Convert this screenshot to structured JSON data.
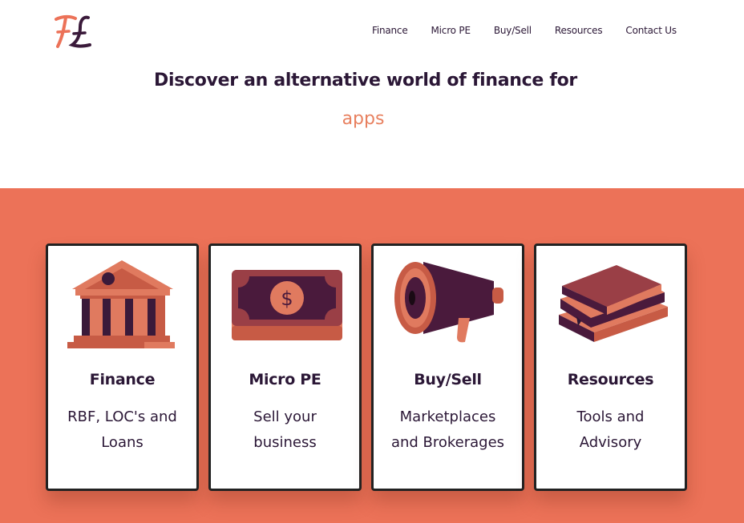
{
  "brand": {
    "logo_text": "FL",
    "colors": {
      "accent": "#ec7258",
      "ink": "#2b1736",
      "coral_text": "#e8805f"
    }
  },
  "nav": {
    "items": [
      {
        "label": "Finance"
      },
      {
        "label": "Micro PE"
      },
      {
        "label": "Buy/Sell"
      },
      {
        "label": "Resources"
      },
      {
        "label": "Contact Us"
      }
    ]
  },
  "hero": {
    "title": "Discover an alternative world of finance for",
    "rotating_word": "apps"
  },
  "cards": [
    {
      "icon": "bank-building-icon",
      "title": "Finance",
      "description": "RBF, LOC's and Loans"
    },
    {
      "icon": "dollar-bill-icon",
      "title": "Micro PE",
      "description": "Sell your business"
    },
    {
      "icon": "megaphone-icon",
      "title": "Buy/Sell",
      "description": "Marketplaces and Brokerages"
    },
    {
      "icon": "books-icon",
      "title": "Resources",
      "description": "Tools and Advisory"
    }
  ]
}
